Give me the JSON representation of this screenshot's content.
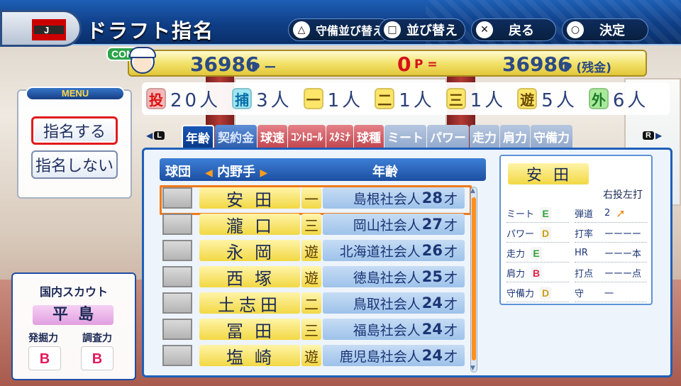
{
  "header": {
    "title": "ドラフト指名",
    "team_logo_letter": "J",
    "buttons": [
      {
        "icon": "triangle-icon",
        "symbol": "△",
        "label": "守備並び替え"
      },
      {
        "icon": "square-icon",
        "symbol": "□",
        "label": "並び替え"
      },
      {
        "icon": "cross-icon",
        "symbol": "✕",
        "label": "戻る"
      },
      {
        "icon": "circle-icon",
        "symbol": "○",
        "label": "決定"
      }
    ]
  },
  "points": {
    "com_label": "COM",
    "total": "36986",
    "total_unit": "P ー",
    "spent": "0",
    "spent_unit": "P =",
    "remaining": "36986",
    "remaining_unit": "P (残金)"
  },
  "positions": [
    {
      "abbr": "投",
      "count": "20人",
      "color": "#f4b9b9",
      "text": "#d11"
    },
    {
      "abbr": "捕",
      "count": "3人",
      "color": "#9ee6f2",
      "text": "#0a6fa8"
    },
    {
      "abbr": "一",
      "count": "1人",
      "color": "#fde56a",
      "text": "#6a4a00"
    },
    {
      "abbr": "二",
      "count": "1人",
      "color": "#fde56a",
      "text": "#6a4a00"
    },
    {
      "abbr": "三",
      "count": "1人",
      "color": "#fde56a",
      "text": "#6a4a00"
    },
    {
      "abbr": "遊",
      "count": "5人",
      "color": "#fde56a",
      "text": "#6a4a00"
    },
    {
      "abbr": "外",
      "count": "6人",
      "color": "#a9ea9a",
      "text": "#1a7a2a"
    }
  ],
  "menu": {
    "title": "MENU",
    "items": [
      "指名する",
      "指名しない"
    ]
  },
  "scout": {
    "title": "国内スカウト",
    "name": "平島",
    "skill_labels": [
      "発掘力",
      "調査力"
    ],
    "skill_grades": [
      "B",
      "B"
    ]
  },
  "tabs": {
    "left_key": "L",
    "right_key": "R",
    "items": [
      {
        "label": "年齢",
        "style": "blue",
        "active": true
      },
      {
        "label": "契約金",
        "style": "blue"
      },
      {
        "label": "球速",
        "style": "red"
      },
      {
        "label": "ｺﾝﾄﾛｰﾙ",
        "style": "red"
      },
      {
        "label": "ｽﾀﾐﾅ",
        "style": "red"
      },
      {
        "label": "球種",
        "style": "red"
      },
      {
        "label": "ミート",
        "style": "gray"
      },
      {
        "label": "パワー",
        "style": "gray"
      },
      {
        "label": "走力",
        "style": "gray"
      },
      {
        "label": "肩力",
        "style": "gray"
      },
      {
        "label": "守備力",
        "style": "gray"
      }
    ]
  },
  "list": {
    "header_team": "球団",
    "header_position": "内野手",
    "header_sort": "年齢",
    "rows": [
      {
        "name": "安田",
        "pos": "一",
        "pref": "島根",
        "type": "社会人",
        "age": "28",
        "age_unit": "才",
        "selected": true
      },
      {
        "name": "瀧口",
        "pos": "三",
        "pref": "岡山",
        "type": "社会人",
        "age": "27",
        "age_unit": "才"
      },
      {
        "name": "永岡",
        "pos": "遊",
        "pref": "北海道",
        "type": "社会人",
        "age": "26",
        "age_unit": "才"
      },
      {
        "name": "西塚",
        "pos": "遊",
        "pref": "徳島",
        "type": "社会人",
        "age": "25",
        "age_unit": "才"
      },
      {
        "name": "土志田",
        "pos": "二",
        "pref": "鳥取",
        "type": "社会人",
        "age": "24",
        "age_unit": "才"
      },
      {
        "name": "冨田",
        "pos": "三",
        "pref": "福島",
        "type": "社会人",
        "age": "24",
        "age_unit": "才"
      },
      {
        "name": "塩崎",
        "pos": "遊",
        "pref": "鹿児島",
        "type": "社会人",
        "age": "24",
        "age_unit": "才"
      }
    ]
  },
  "detail": {
    "name": "安田",
    "handedness": "右投左打",
    "stats_left": [
      {
        "label": "ミート",
        "grade": "E"
      },
      {
        "label": "パワー",
        "grade": "D"
      },
      {
        "label": "走力",
        "grade": "E"
      },
      {
        "label": "肩力",
        "grade": "B"
      },
      {
        "label": "守備力",
        "grade": "D"
      }
    ],
    "stats_right": [
      {
        "label": "弾道",
        "value": "2"
      },
      {
        "label": "打率",
        "value": "ーーーー"
      },
      {
        "label": "HR",
        "value": "ーーー本"
      },
      {
        "label": "打点",
        "value": "ーーー点"
      },
      {
        "label": "守",
        "value": "一"
      }
    ]
  }
}
